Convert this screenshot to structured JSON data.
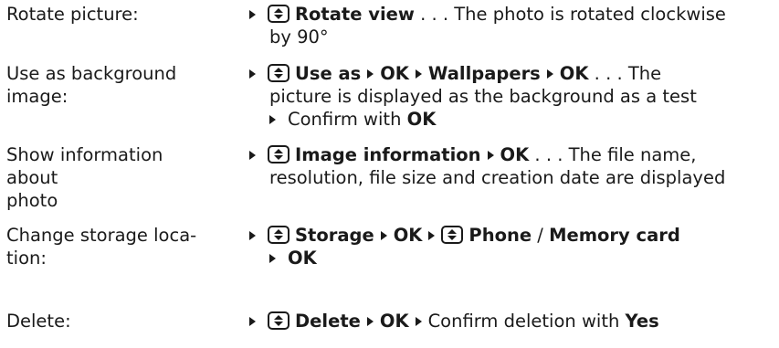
{
  "rows": [
    {
      "label": [
        "Rotate picture:"
      ],
      "lines": [
        {
          "k1": "Rotate view",
          "t1": " . . . The photo is rotated clockwise"
        },
        {
          "t1": "by 90°"
        }
      ]
    },
    {
      "label": [
        "Use as background",
        "image:"
      ],
      "lines": [
        {
          "k1": "Use as",
          "k2": "OK",
          "k3": "Wallpapers",
          "k4": "OK",
          "t1": " . . . The"
        },
        {
          "t1": "picture is displayed as the background as a test"
        },
        {
          "t1": "Confirm with ",
          "k1": "OK"
        }
      ]
    },
    {
      "label": [
        "Show information",
        "about",
        "photo"
      ],
      "lines": [
        {
          "k1": "Image information",
          "k2": "OK",
          "t1": " . . . The file name,"
        },
        {
          "t1": "resolution, file size and creation date are displayed"
        }
      ]
    },
    {
      "label": [
        "Change storage loca-",
        "tion:"
      ],
      "lines": [
        {
          "k1": "Storage",
          "k2": "OK",
          "k3": "Phone",
          "t1": " / ",
          "k4": "Memory card"
        },
        {
          "k1": "OK"
        }
      ]
    },
    {
      "label": [
        "Delete:"
      ],
      "lines": [
        {
          "k1": "Delete",
          "k2": "OK",
          "t1": "Confirm deletion with ",
          "k3": "Yes"
        }
      ]
    }
  ]
}
